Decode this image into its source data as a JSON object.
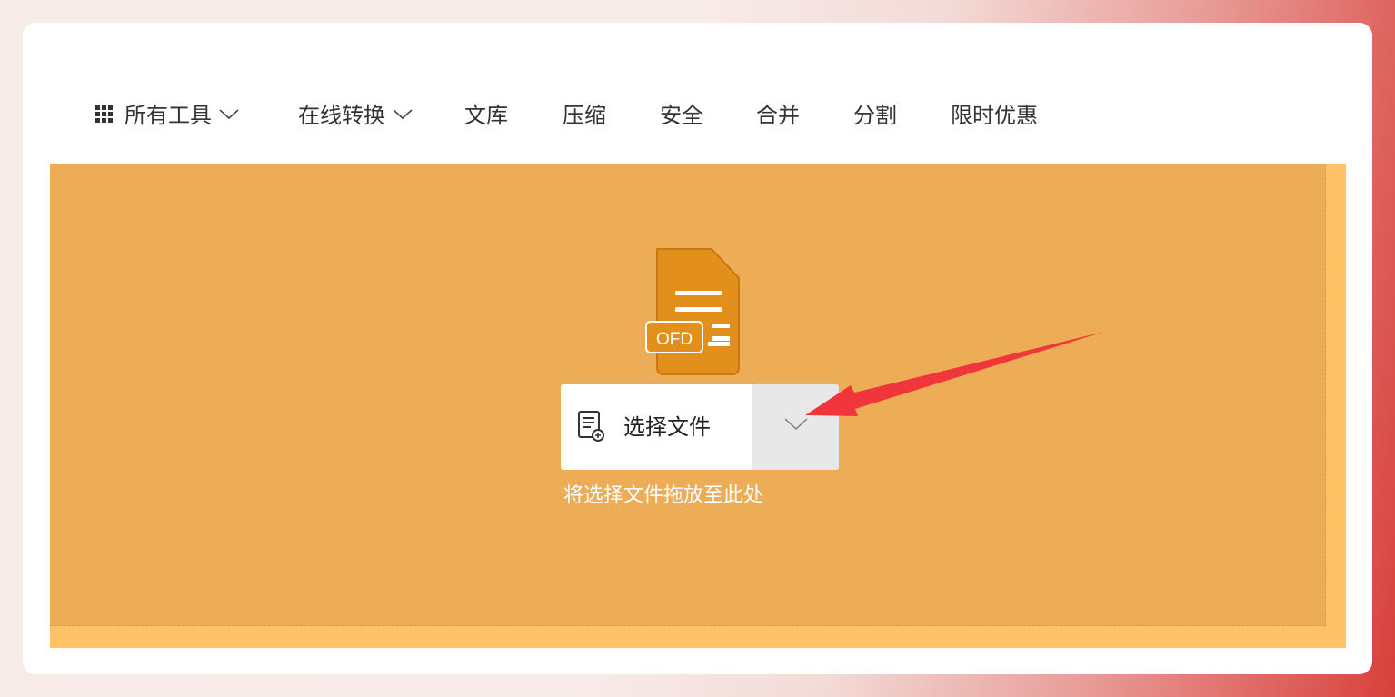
{
  "nav": {
    "items": [
      {
        "label": "所有工具",
        "icon": "grid-icon",
        "dropdown": true
      },
      {
        "label": "在线转换",
        "dropdown": true
      },
      {
        "label": "文库"
      },
      {
        "label": "压缩"
      },
      {
        "label": "安全"
      },
      {
        "label": "合并"
      },
      {
        "label": "分割"
      },
      {
        "label": "限时优惠"
      }
    ]
  },
  "upload": {
    "file_type_badge": "OFD",
    "select_button_label": "选择文件",
    "select_button_icon": "add-file-icon",
    "dropdown_icon": "chevron-down-icon",
    "drop_hint": "将选择文件拖放至此处"
  },
  "colors": {
    "drop_zone": "#edac56",
    "drop_zone_edge": "#ffc264",
    "doc_icon": "#e28f1c",
    "annotation_arrow": "#f0363a"
  }
}
